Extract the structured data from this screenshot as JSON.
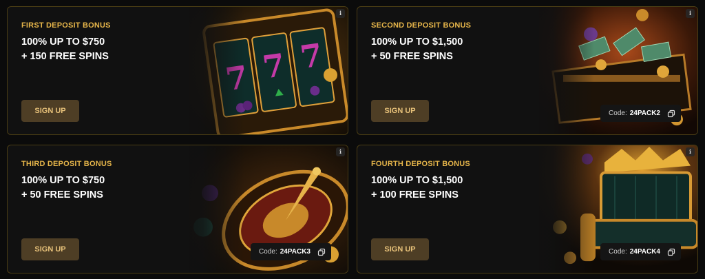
{
  "cards": [
    {
      "label": "FIRST DEPOSIT BONUS",
      "line1": "100% UP TO $750",
      "line2": "+ 150 FREE SPINS",
      "button": "SIGN UP",
      "info": "i",
      "image": "slot-machine"
    },
    {
      "label": "SECOND DEPOSIT BONUS",
      "line1": "100% UP TO $1,500",
      "line2": "+ 50 FREE SPINS",
      "button": "SIGN UP",
      "info": "i",
      "code_prefix": "Code:",
      "code_value": "24PACK2",
      "image": "treasure-chest"
    },
    {
      "label": "THIRD DEPOSIT BONUS",
      "line1": "100% UP TO $750",
      "line2": "+ 50 FREE SPINS",
      "button": "SIGN UP",
      "info": "i",
      "code_prefix": "Code:",
      "code_value": "24PACK3",
      "image": "roulette-wheel"
    },
    {
      "label": "FOURTH DEPOSIT BONUS",
      "line1": "100% UP TO $1,500",
      "line2": "+ 100 FREE SPINS",
      "button": "SIGN UP",
      "info": "i",
      "code_prefix": "Code:",
      "code_value": "24PACK4",
      "image": "golden-throne"
    }
  ],
  "colors": {
    "accent": "#e7b64a",
    "button_bg": "#4e3e25",
    "card_border": "#4a3d14",
    "card_bg": "#111111"
  }
}
